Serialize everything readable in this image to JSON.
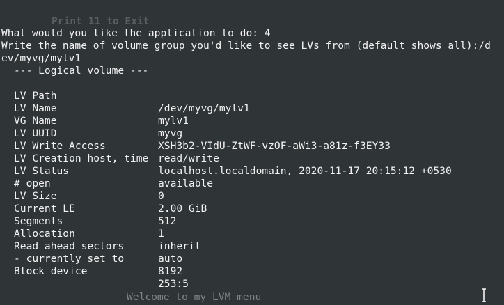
{
  "terminal": {
    "faded_top": "Print 11 to Exit",
    "prompt_line": "What would you like the application to do: 4",
    "lv_prompt_1": "Write the name of volume group you'd like to see LVs from (default shows all):/d",
    "lv_prompt_2": "ev/myvg/mylv1",
    "section_header": "--- Logical volume ---",
    "fields": [
      {
        "key": "LV Path",
        "value": "/dev/myvg/mylv1"
      },
      {
        "key": "LV Name",
        "value": "mylv1"
      },
      {
        "key": "VG Name",
        "value": "myvg"
      },
      {
        "key": "LV UUID",
        "value": "XSH3b2-VIdU-ZtWF-vzOF-aWi3-a81z-f3EY33"
      },
      {
        "key": "LV Write Access",
        "value": "read/write"
      },
      {
        "key": "LV Creation host, time",
        "value": "localhost.localdomain, 2020-11-17 20:15:12 +0530"
      },
      {
        "key": "LV Status",
        "value": "available"
      },
      {
        "key": "# open",
        "value": "0"
      },
      {
        "key": "LV Size",
        "value": "2.00 GiB"
      },
      {
        "key": "Current LE",
        "value": "512"
      },
      {
        "key": "Segments",
        "value": "1"
      },
      {
        "key": "Allocation",
        "value": "inherit"
      },
      {
        "key": "Read ahead sectors",
        "value": "auto"
      },
      {
        "key": "- currently set to",
        "value": "8192"
      },
      {
        "key": "Block device",
        "value": "253:5"
      }
    ],
    "faded_bottom": "Welcome to my LVM menu",
    "cursor_icon": "text-cursor-icon",
    "colors": {
      "background": "#2f3437",
      "text": "#f2f2f2",
      "faded_text": "#585e62"
    }
  }
}
